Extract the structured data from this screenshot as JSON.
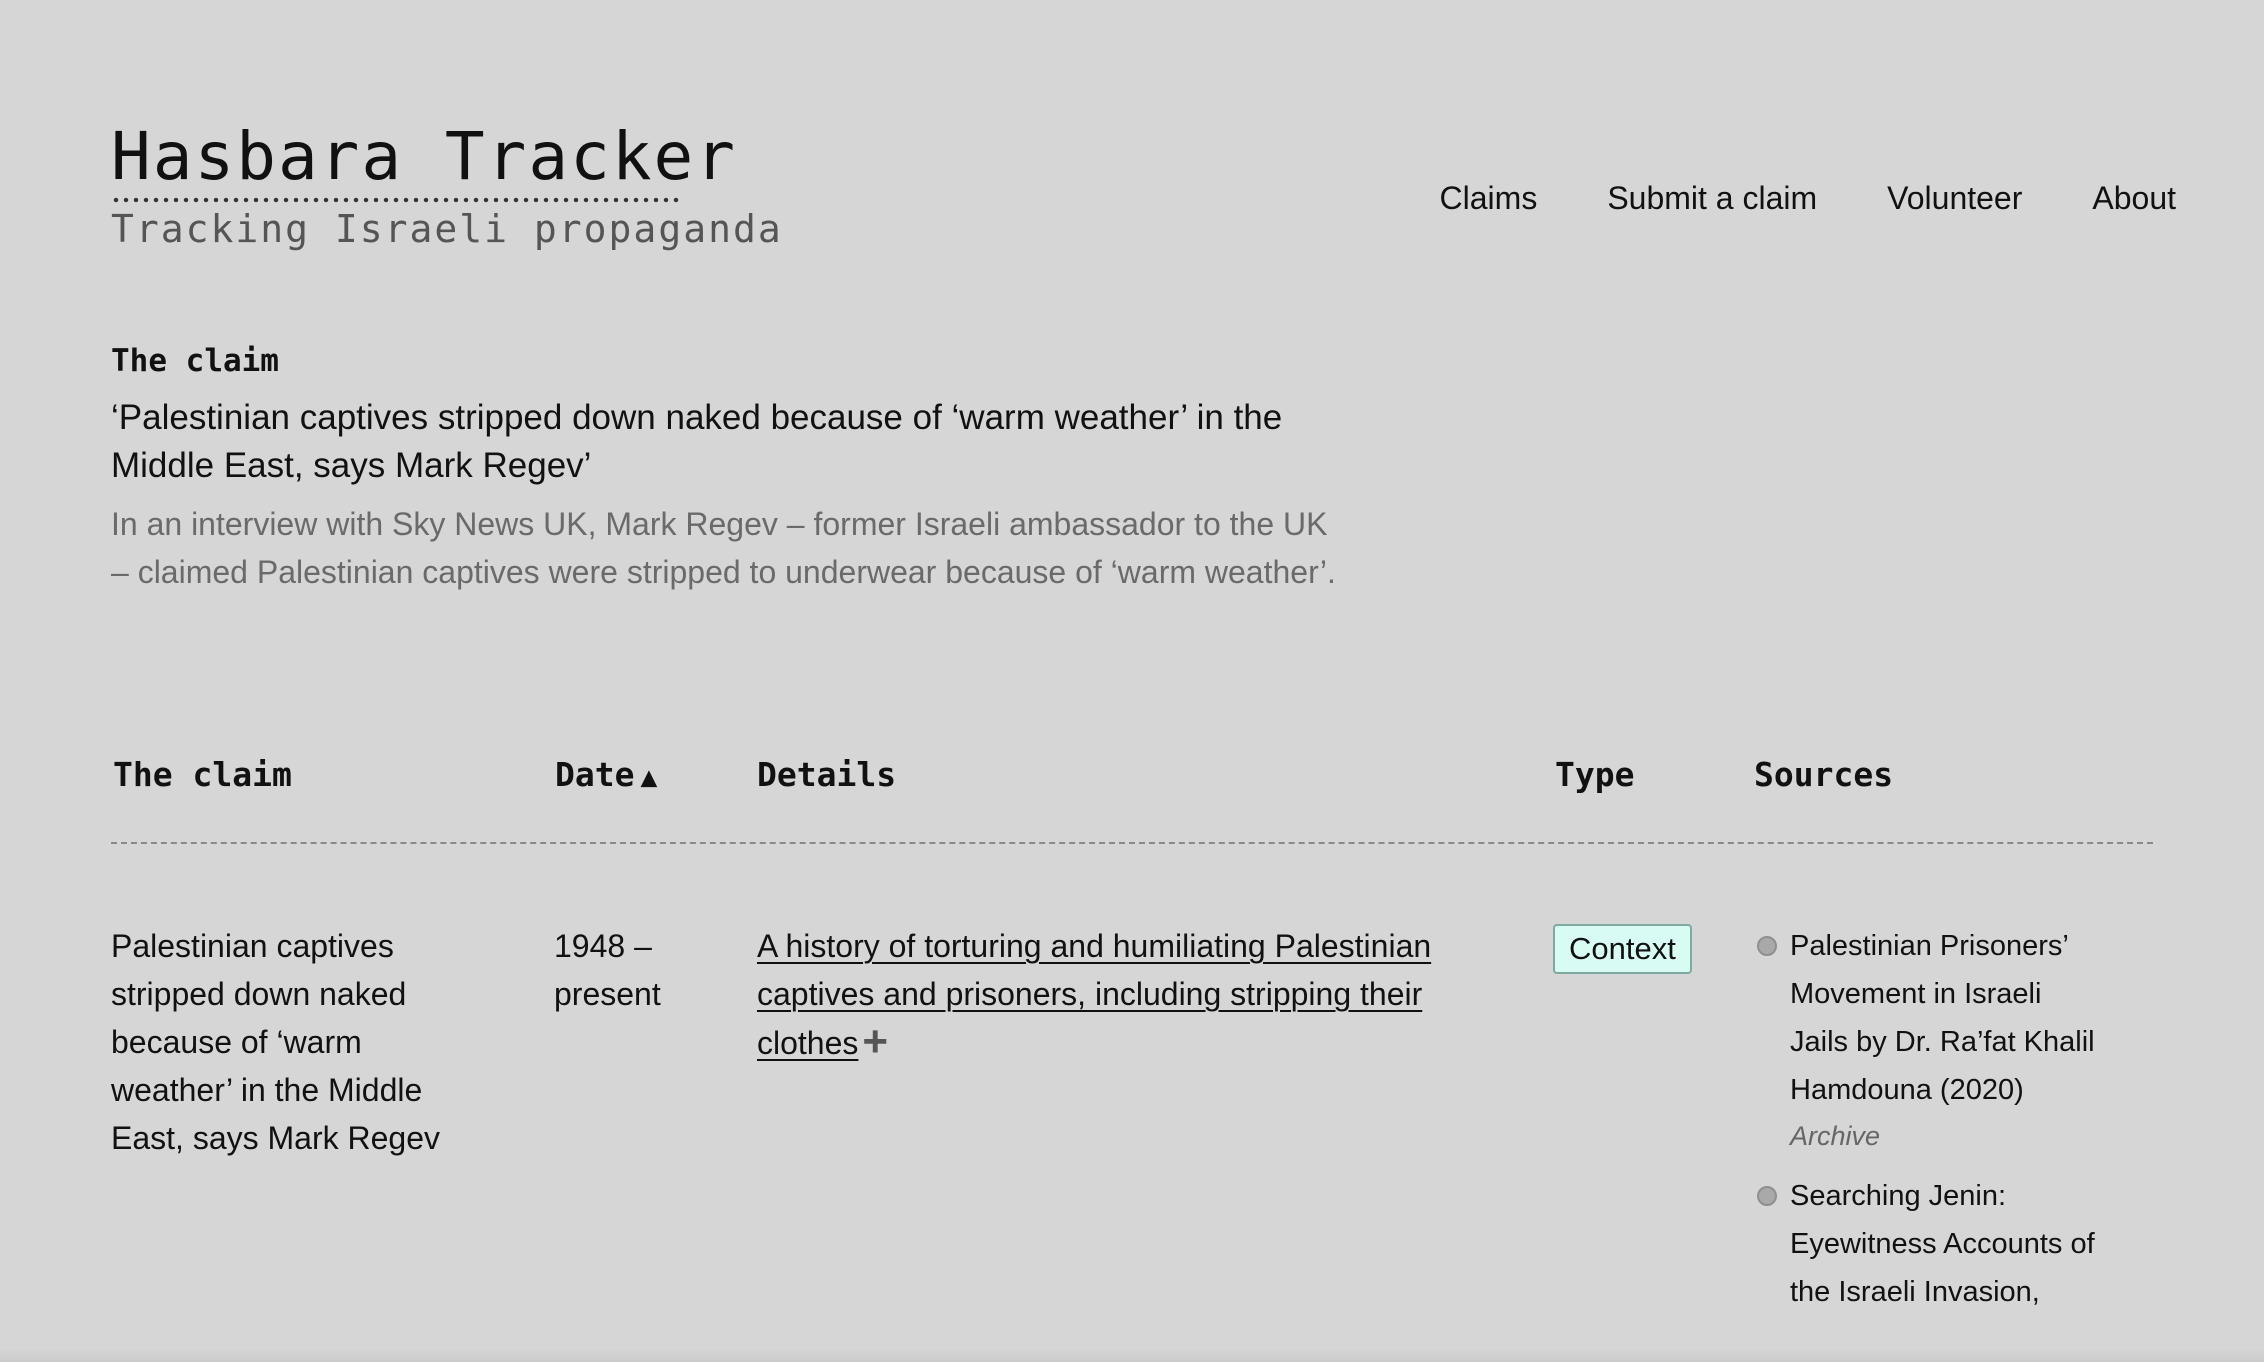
{
  "brand": {
    "title": "Hasbara Tracker",
    "subtitle": "Tracking Israeli propaganda"
  },
  "nav": {
    "items": [
      "Claims",
      "Submit a claim",
      "Volunteer",
      "About"
    ]
  },
  "intro": {
    "label": "The claim",
    "title": "‘Palestinian captives stripped down naked because of ‘warm weather’ in the Middle East, says Mark Regev’",
    "description": "In an interview with Sky News UK, Mark Regev – former Israeli ambassador to the UK – claimed Palestinian captives were stripped to underwear because of ‘warm weather’."
  },
  "table": {
    "headers": {
      "claim": "The claim",
      "date": "Date",
      "date_sort_arrow": "▲",
      "details": "Details",
      "type": "Type",
      "sources": "Sources"
    },
    "rows": [
      {
        "claim": "Palestinian captives stripped down naked because of ‘warm weather’ in the Middle East, says Mark Regev",
        "date": "1948 – present",
        "details_link": "A history of torturing and humiliating Palestinian captives and prisoners, including stripping their clothes",
        "expand_glyph": "+",
        "type": "Context",
        "type_color": "#d8fbf4",
        "sources": [
          {
            "title": "Palestinian Prisoners’ Movement in Israeli Jails by Dr. Ra’fat Khalil Hamdouna (2020)",
            "archive": "Archive"
          },
          {
            "title": "Searching Jenin: Eyewitness Accounts of the Israeli Invasion,",
            "archive": ""
          }
        ]
      }
    ]
  }
}
